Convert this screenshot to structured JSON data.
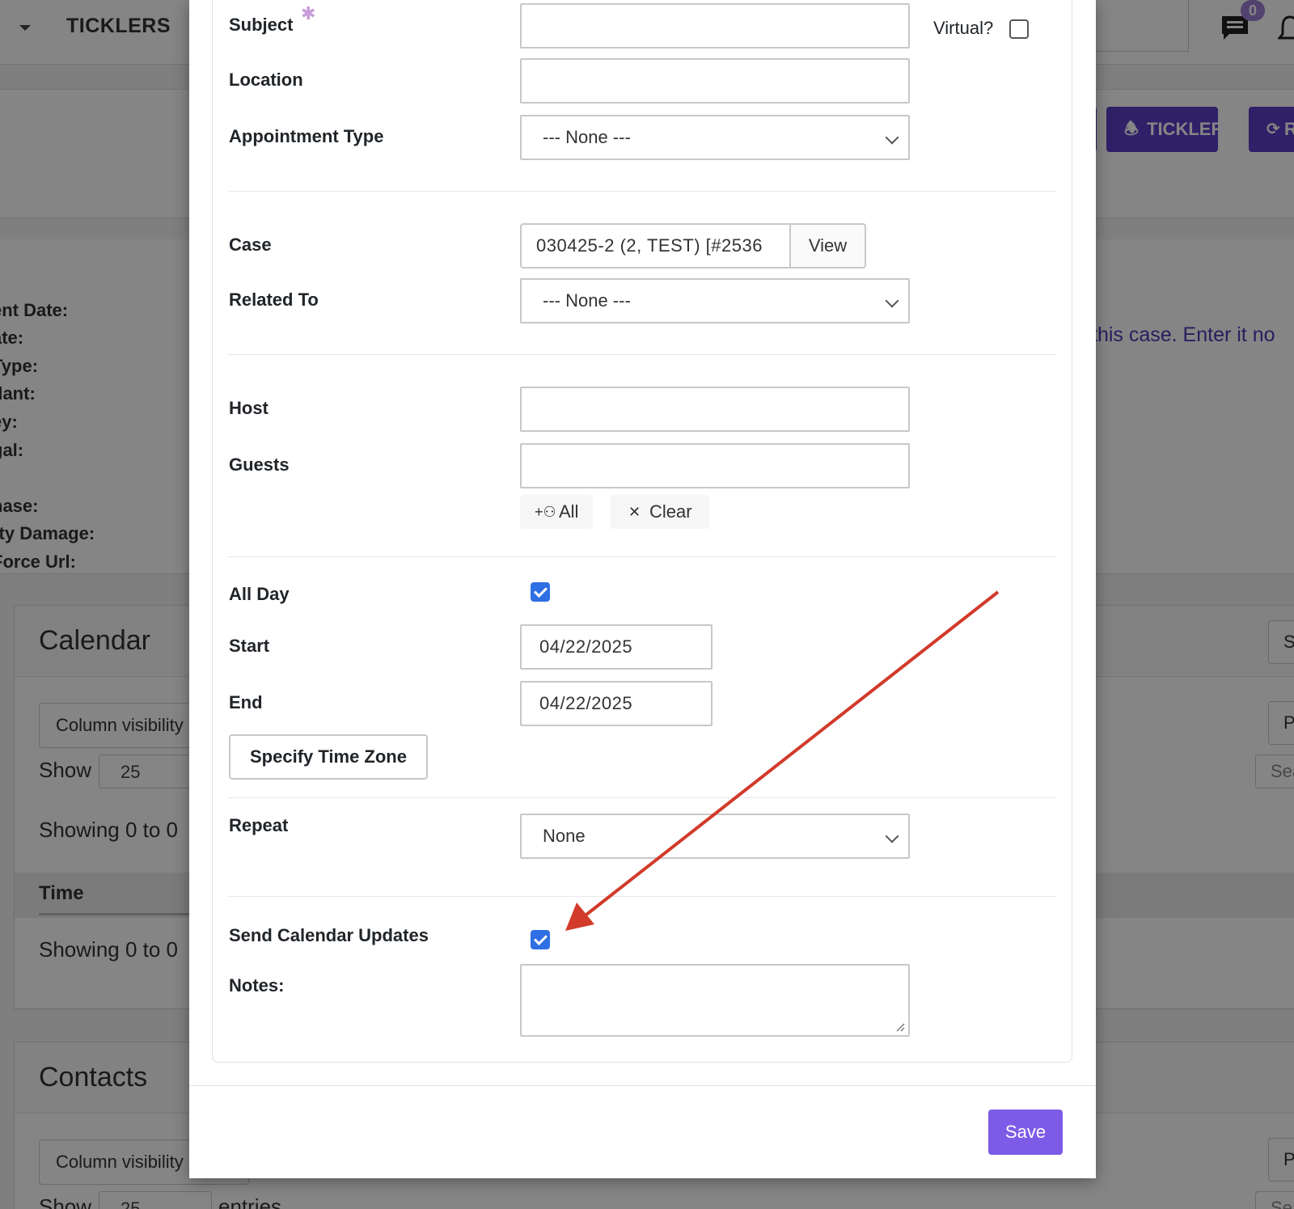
{
  "background": {
    "nav_title": "TICKLERS",
    "message_badge": "0",
    "buttons": {
      "tickler": "TICKLER",
      "refresh_partial": "R"
    },
    "info_labels": [
      ":",
      "ent Date:",
      "ate:",
      "Type:",
      "dant:",
      "ey:",
      "gal:",
      ":",
      "hase:",
      "rty Damage:",
      "Force Url:"
    ],
    "notice_text": "this case. Enter it no",
    "calendar": {
      "title": "Calendar",
      "column_visibility": "Column visibility",
      "show_label": "Show",
      "show_value": "25",
      "showing_top": "Showing 0 to 0",
      "table_header": "Time",
      "showing_bottom": "Showing 0 to 0",
      "right_show": "Sho",
      "right_print": "Pri",
      "right_search": "Sear"
    },
    "contacts": {
      "title": "Contacts",
      "column_visibility": "Column visibility",
      "show_label": "Show",
      "show_value": "25",
      "entries": "entries",
      "right_print": "Pri",
      "right_search": "Sea"
    }
  },
  "modal": {
    "fields": {
      "subject_label": "Subject",
      "subject_value": "",
      "virtual_label": "Virtual?",
      "virtual_checked": false,
      "location_label": "Location",
      "location_value": "",
      "appointment_type_label": "Appointment Type",
      "appointment_type_value": "--- None ---",
      "case_label": "Case",
      "case_value": "030425-2 (2, TEST) [#2536",
      "case_view_button": "View",
      "related_to_label": "Related To",
      "related_to_value": "--- None ---",
      "host_label": "Host",
      "host_value": "",
      "guests_label": "Guests",
      "guests_value": "",
      "all_button": "All",
      "clear_button": "Clear",
      "all_day_label": "All Day",
      "all_day_checked": true,
      "start_label": "Start",
      "start_value": "04/22/2025",
      "end_label": "End",
      "end_value": "04/22/2025",
      "timezone_button": "Specify Time Zone",
      "repeat_label": "Repeat",
      "repeat_value": "None",
      "send_updates_label": "Send Calendar Updates",
      "send_updates_checked": true,
      "notes_label": "Notes:",
      "notes_value": ""
    },
    "save_button": "Save"
  },
  "colors": {
    "primary_purple": "#5b3ec8",
    "save_purple": "#7d5be6",
    "checkbox_blue": "#2f6fe4",
    "annotation_arrow": "#d23a2a",
    "notice_text": "#4b3bb4"
  },
  "icons": {
    "nav_caret": "caret-down-icon",
    "messages": "chat-icon",
    "notifications": "bell-icon",
    "tickler": "bell-icon",
    "refresh": "refresh-icon",
    "select_chevron": "chevron-down-icon",
    "add_all_guests": "user-plus-icon",
    "clear_guests": "close-icon",
    "annotation": "arrow-icon"
  }
}
